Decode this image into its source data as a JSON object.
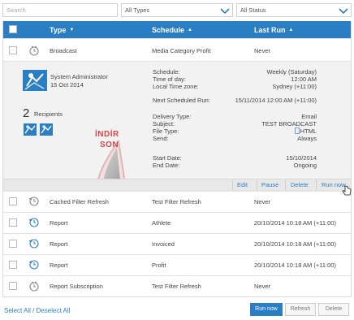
{
  "filters": {
    "search_placeholder": "Search",
    "type_value": "All Types",
    "status_value": "All Status"
  },
  "table": {
    "headers": {
      "type": "Type",
      "schedule": "Schedule",
      "last_run": "Last Run"
    },
    "expanded": {
      "type": "Broadcast",
      "schedule": "Media Category Profit",
      "last_run": "Never"
    },
    "detail": {
      "user_name": "System Administrator",
      "user_date": "15 Oct 2014",
      "recipient_count": "2",
      "recipient_label": "Recipients",
      "fields": [
        {
          "label": "Schedule:",
          "value": "Weekly (Saturday)"
        },
        {
          "label": "Time of day:",
          "value": "12:00 AM"
        },
        {
          "label": "Local Time zone:",
          "value": "Sydney (+11:00)"
        },
        {
          "label": "Next Scheduled Run:",
          "value": "15/11/2014 12:00 AM (+11:00)"
        },
        {
          "label": "Delivery Type:",
          "value": "Email"
        },
        {
          "label": "Subject:",
          "value": "TEST BROADCAST"
        },
        {
          "label": "File Type:",
          "value": "HTML"
        },
        {
          "label": "Send:",
          "value": "Always"
        },
        {
          "label": "Start Date:",
          "value": "15/10/2014"
        },
        {
          "label": "End Date:",
          "value": "Ongoing"
        }
      ],
      "watermark_line1": "İNDİR",
      "watermark_line2": "SON"
    },
    "row_actions": {
      "edit": "Edit",
      "pause": "Pause",
      "delete": "Delete",
      "run_now": "Run now"
    },
    "rows": [
      {
        "type": "Cached Filter Refresh",
        "schedule": "Test Filter Refresh",
        "last_run": "Never"
      },
      {
        "type": "Report",
        "schedule": "Athlete",
        "last_run": "20/10/2014 10:18 AM (+11:00)"
      },
      {
        "type": "Report",
        "schedule": "Invoiced",
        "last_run": "20/10/2014 10:18 AM (+11:00)"
      },
      {
        "type": "Report",
        "schedule": "Profit",
        "last_run": "20/10/2014 10:18 AM (+11:00)"
      },
      {
        "type": "Report Subscription",
        "schedule": "Test Filter Refresh",
        "last_run": "Never"
      }
    ]
  },
  "footer": {
    "select_all": "Select All / Deselect All",
    "run_now": "Run now",
    "refresh": "Refresh",
    "delete": "Delete"
  },
  "colors": {
    "accent": "#2a7fc4",
    "header_bg": "#2a7fc4",
    "detail_bg": "#f2f2f2"
  }
}
